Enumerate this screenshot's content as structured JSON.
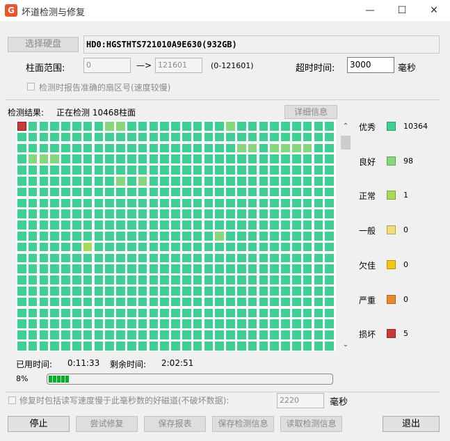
{
  "window": {
    "title": "坏道检测与修复",
    "app_icon_glyph": "G",
    "minimize_glyph": "—",
    "maximize_glyph": "☐",
    "close_glyph": "✕"
  },
  "top": {
    "select_disk_label": "选择硬盘",
    "disk_name": "HD0:HGSTHTS721010A9E630(932GB)",
    "cylinder_range_label": "柱面范围:",
    "cylinder_start": "0",
    "arrow": "—>",
    "cylinder_end": "121601",
    "cylinder_range_hint": "(0-121601)",
    "timeout_label": "超时时间:",
    "timeout_value": "3000",
    "timeout_unit": "毫秒",
    "report_sector_label": "检测时报告准确的扇区号(速度较慢)"
  },
  "result": {
    "label": "检测结果:",
    "status": "正在检测 10468柱面",
    "details_button": "详细信息"
  },
  "grid": {
    "columns": 29,
    "rows": 21,
    "colors": {
      "excellent": "#3ecf94",
      "good": "#87d87c",
      "normal": "#a8d957",
      "fair": "#f2dc7a",
      "poor": "#f5c417",
      "serious": "#e9882e",
      "damaged": "#c8393b",
      "empty": "#ffffff"
    },
    "cells": [
      {
        "row": 0,
        "col": 0,
        "status": "damaged"
      },
      {
        "row": 0,
        "col": 8,
        "status": "good"
      },
      {
        "row": 0,
        "col": 9,
        "status": "good"
      },
      {
        "row": 0,
        "col": 19,
        "status": "good"
      },
      {
        "row": 2,
        "col": 20,
        "status": "good"
      },
      {
        "row": 2,
        "col": 21,
        "status": "good"
      },
      {
        "row": 2,
        "col": 23,
        "status": "good"
      },
      {
        "row": 2,
        "col": 24,
        "status": "good"
      },
      {
        "row": 2,
        "col": 25,
        "status": "good"
      },
      {
        "row": 2,
        "col": 26,
        "status": "good"
      },
      {
        "row": 3,
        "col": 1,
        "status": "good"
      },
      {
        "row": 3,
        "col": 2,
        "status": "good"
      },
      {
        "row": 3,
        "col": 3,
        "status": "good"
      },
      {
        "row": 5,
        "col": 9,
        "status": "good"
      },
      {
        "row": 5,
        "col": 11,
        "status": "good"
      },
      {
        "row": 10,
        "col": 18,
        "status": "good"
      },
      {
        "row": 11,
        "col": 6,
        "status": "normal"
      }
    ]
  },
  "legend": [
    {
      "key": "excellent",
      "label": "优秀",
      "count": "10364"
    },
    {
      "key": "good",
      "label": "良好",
      "count": "98"
    },
    {
      "key": "normal",
      "label": "正常",
      "count": "1"
    },
    {
      "key": "fair",
      "label": "一般",
      "count": "0"
    },
    {
      "key": "poor",
      "label": "欠佳",
      "count": "0"
    },
    {
      "key": "serious",
      "label": "严重",
      "count": "0"
    },
    {
      "key": "damaged",
      "label": "损坏",
      "count": "5"
    }
  ],
  "time": {
    "used_label": "已用时间:",
    "used_value": "0:11:33",
    "remaining_label": "剩余时间:",
    "remaining_value": "2:02:51"
  },
  "progress": {
    "percent_text": "8%",
    "fraction": 0.08
  },
  "repair_option": {
    "label": "修复时包括读写速度慢于此毫秒数的好磁道(不破坏数据):",
    "value": "2220",
    "unit": "毫秒"
  },
  "buttons": {
    "stop": "停止",
    "try_repair": "尝试修复",
    "save_report": "保存报表",
    "save_detection": "保存检测信息",
    "read_detection": "读取检测信息",
    "exit": "退出"
  }
}
